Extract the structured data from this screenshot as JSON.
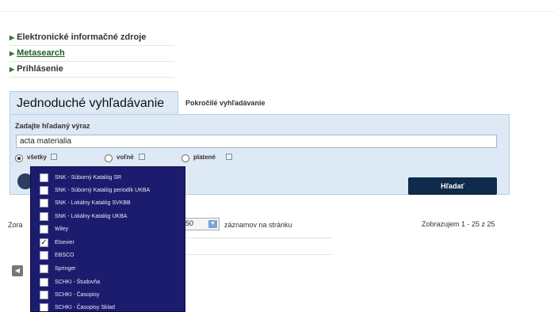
{
  "nav_links": [
    {
      "label": "Elektronické informačné zdroje"
    },
    {
      "label": "Metasearch"
    },
    {
      "label": "Prihlásenie"
    }
  ],
  "tabs": {
    "simple": "Jednoduché vyhľadávanie",
    "advanced": "Pokročilé vyhľadávanie"
  },
  "search": {
    "label": "Zadajte hľadaný výraz",
    "value": "acta materialia"
  },
  "radios": {
    "all": "všetky",
    "free": "voľné",
    "paid": "platené"
  },
  "search_button": "Hľadať",
  "sort_label": "Zora",
  "per_page": {
    "value": "50",
    "suffix": "záznamov na stránku"
  },
  "results_count": "Zobrazujem 1 - 25 z 25",
  "dropdown": {
    "items": [
      {
        "label": "SNK - Súborný Katalóg SR",
        "checked": false
      },
      {
        "label": "SNK - Súborný Katalóg periodík UKBA",
        "checked": false
      },
      {
        "label": "SNK - Lokálny Katalóg SVKBB",
        "checked": false
      },
      {
        "label": "SNK - Lokálny Katalóg UKBA",
        "checked": false
      },
      {
        "label": "Wiley",
        "checked": false
      },
      {
        "label": "Elsevier",
        "checked": true
      },
      {
        "label": "EBSCO",
        "checked": false
      },
      {
        "label": "Springer",
        "checked": false
      },
      {
        "label": "SCHKI - Študovňa",
        "checked": false
      },
      {
        "label": "SCHKI - Časopisy",
        "checked": false
      },
      {
        "label": "SCHKI - Časopisy Sklad",
        "checked": false
      }
    ]
  },
  "colors": {
    "dropdown_bg": "#1c1c6e",
    "panel_bg": "#dde9f5",
    "button_bg": "#0f2a4a",
    "link_bullet": "#2f7a2f"
  }
}
